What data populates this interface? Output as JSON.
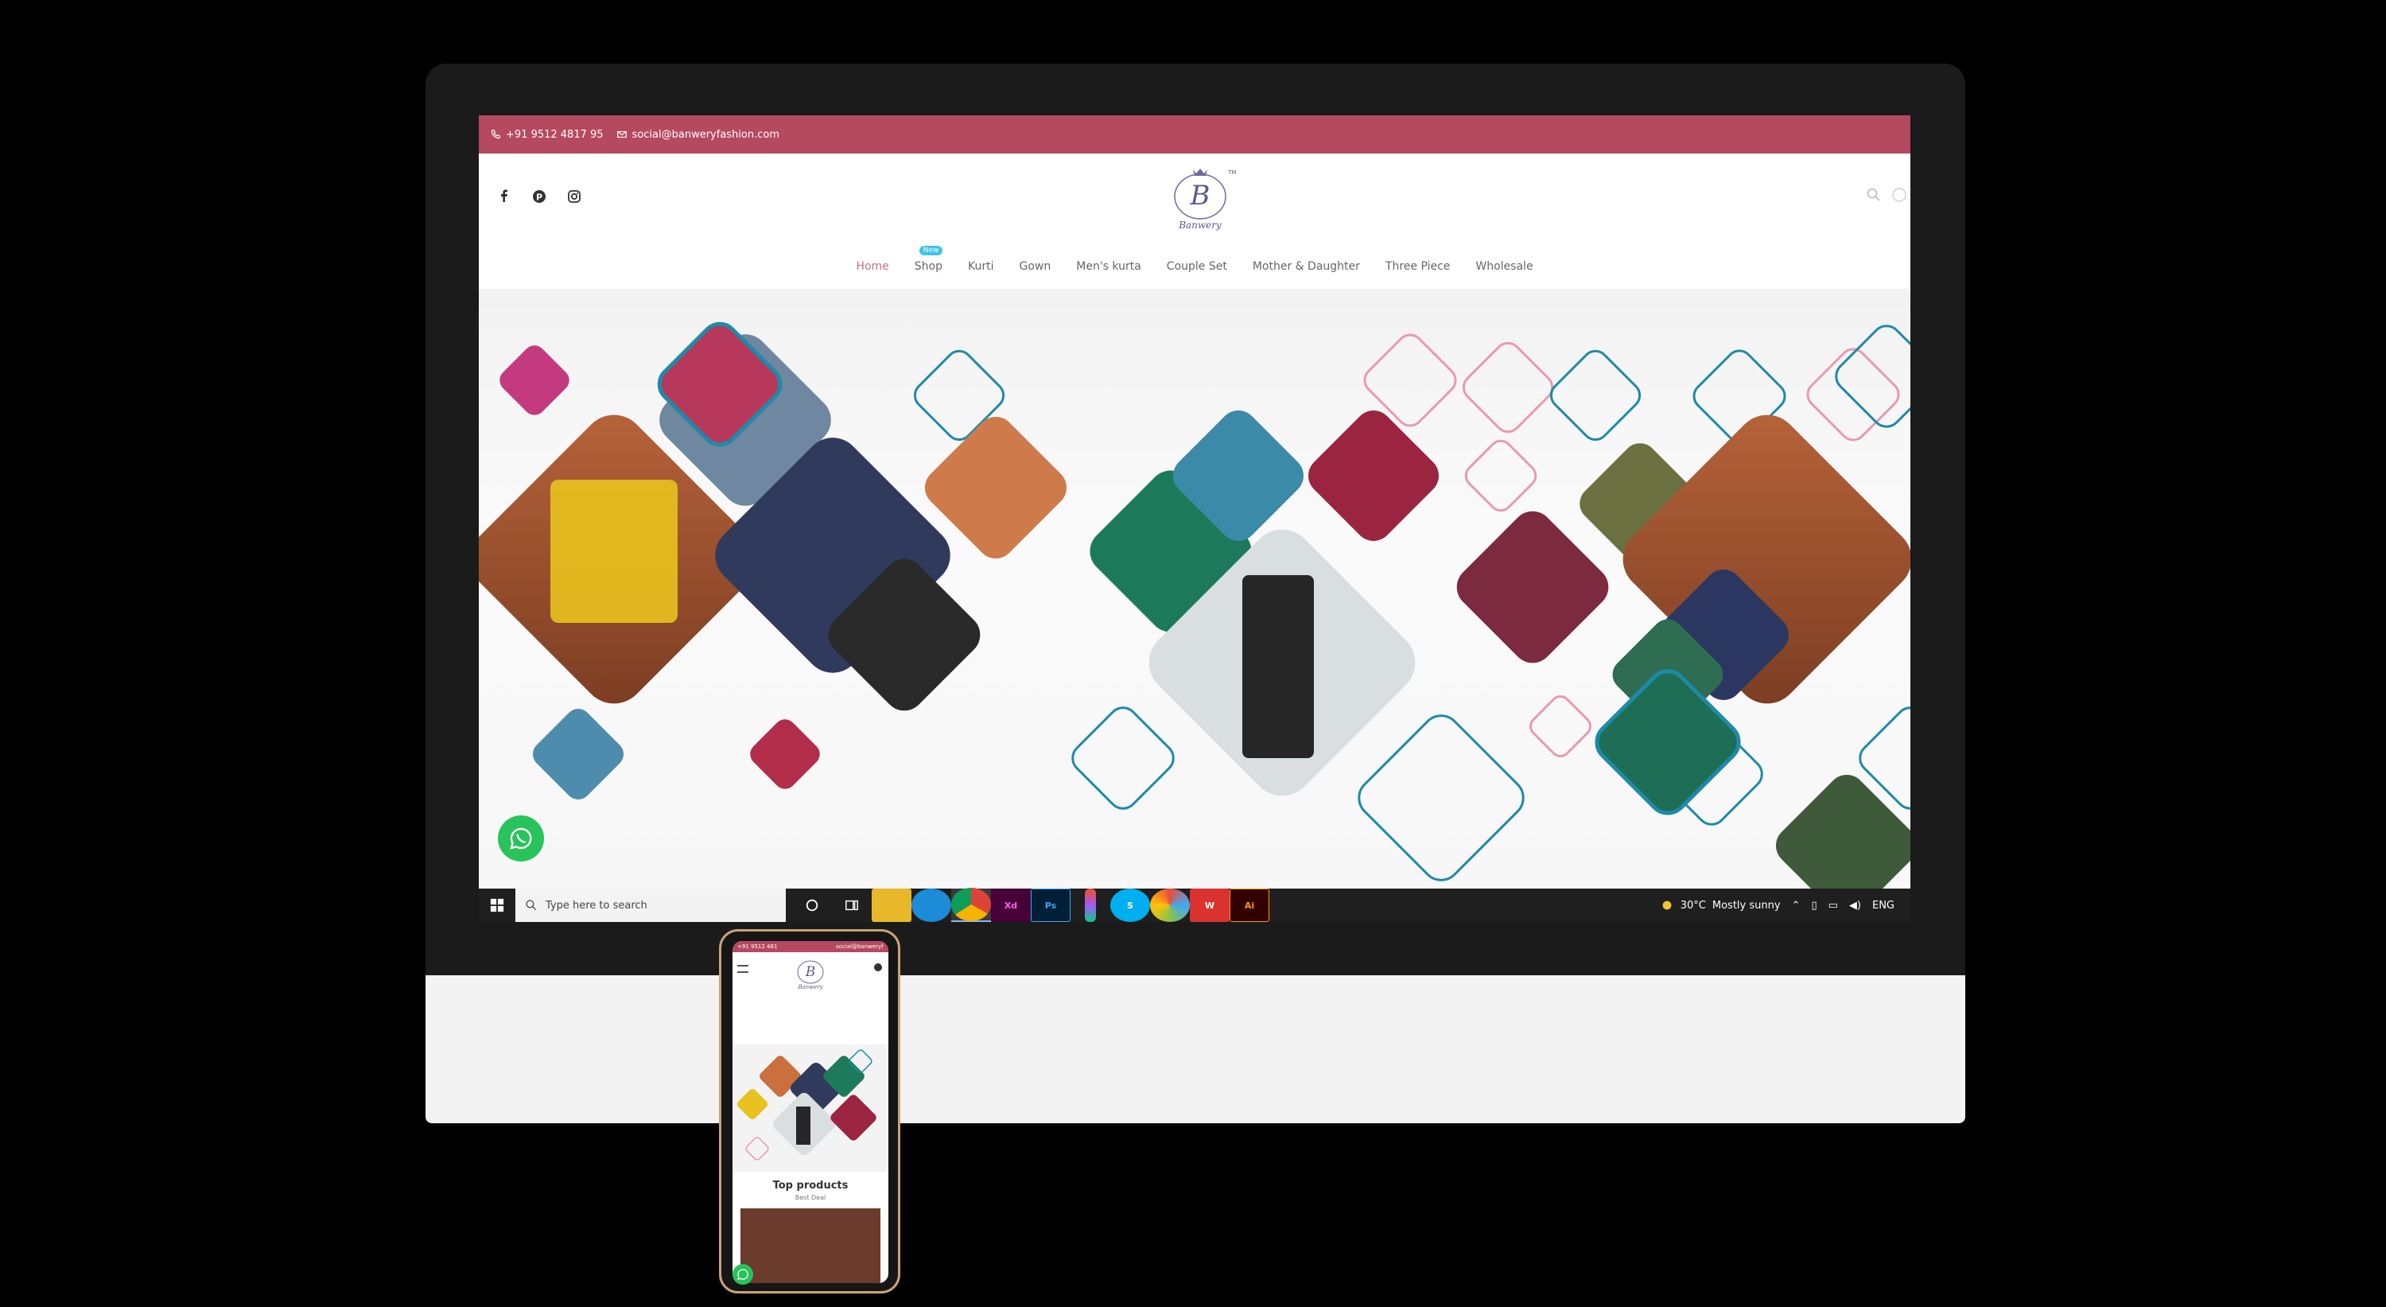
{
  "topbar": {
    "phone": "+91 9512 4817 95",
    "email": "social@banweryfashion.com"
  },
  "brand": {
    "logo_letter": "B",
    "logo_name": "Banwery",
    "trademark": "TM"
  },
  "nav": {
    "items": [
      "Home",
      "Shop",
      "Kurti",
      "Gown",
      "Men's kurta",
      "Couple Set",
      "Mother & Daughter",
      "Three Piece",
      "Wholesale"
    ],
    "active": "Home",
    "new_badge": "New"
  },
  "taskbar": {
    "search_placeholder": "Type here to search",
    "weather_temp": "30°C",
    "weather_text": "Mostly sunny",
    "language": "ENG"
  },
  "phone": {
    "section_title": "Top products",
    "section_subtitle": "Best Deal"
  },
  "colors": {
    "accent": "#b5495f",
    "teal_frame": "#1e8aa8",
    "pink_frame": "#e89aae",
    "whatsapp": "#29c35b"
  }
}
